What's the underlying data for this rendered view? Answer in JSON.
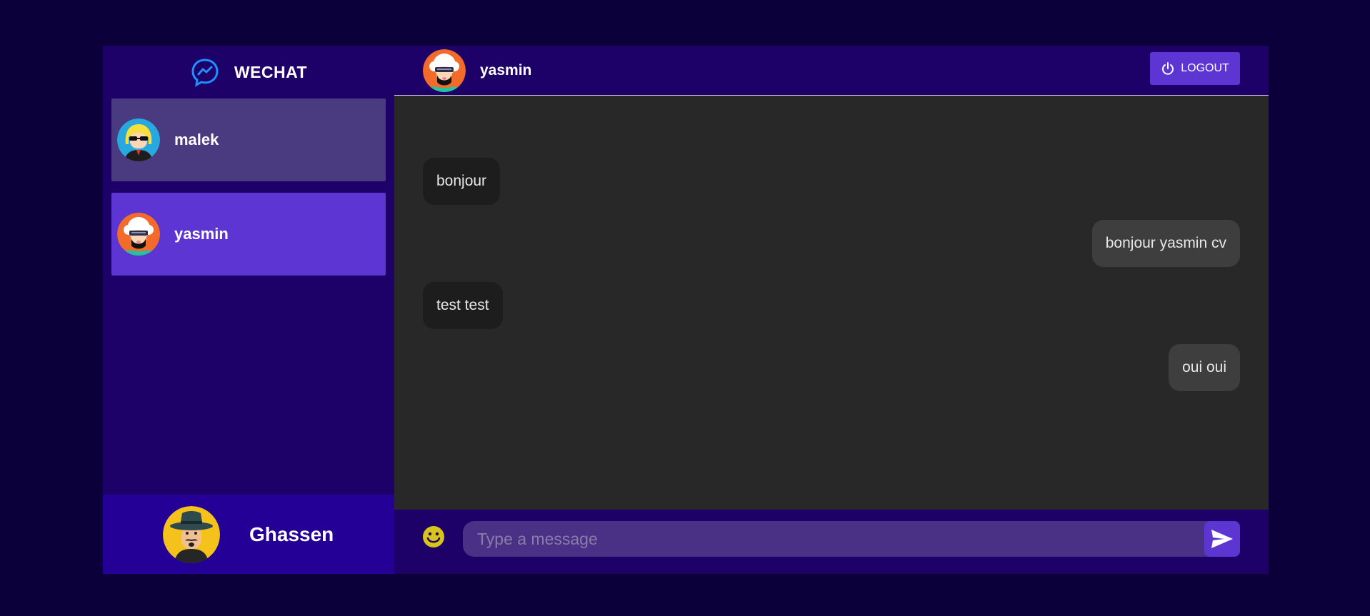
{
  "brand": {
    "name": "WECHAT",
    "icon": "messenger-icon"
  },
  "conversations": [
    {
      "name": "malek",
      "avatar": "avatar-blonde-sunglasses",
      "selected": false
    },
    {
      "name": "yasmin",
      "avatar": "avatar-white-hair-visor",
      "selected": true
    }
  ],
  "current_user": {
    "name": "Ghassen",
    "avatar": "avatar-fedora-mustache"
  },
  "chat": {
    "contact_name": "yasmin",
    "contact_avatar": "avatar-white-hair-visor",
    "logout_label": "LOGOUT",
    "logout_icon": "power-icon",
    "messages": [
      {
        "text": "bonjour",
        "direction": "incoming"
      },
      {
        "text": "bonjour yasmin cv",
        "direction": "outgoing"
      },
      {
        "text": "test test",
        "direction": "incoming"
      },
      {
        "text": "oui oui",
        "direction": "outgoing"
      }
    ]
  },
  "composer": {
    "placeholder": "Type a message",
    "value": "",
    "emoji_icon": "emoji-icon",
    "send_icon": "send-icon"
  },
  "colors": {
    "page_bg": "#0c003a",
    "sidebar_bg": "#1d0068",
    "accent": "#5d35d2",
    "chat_bg": "#282828"
  }
}
